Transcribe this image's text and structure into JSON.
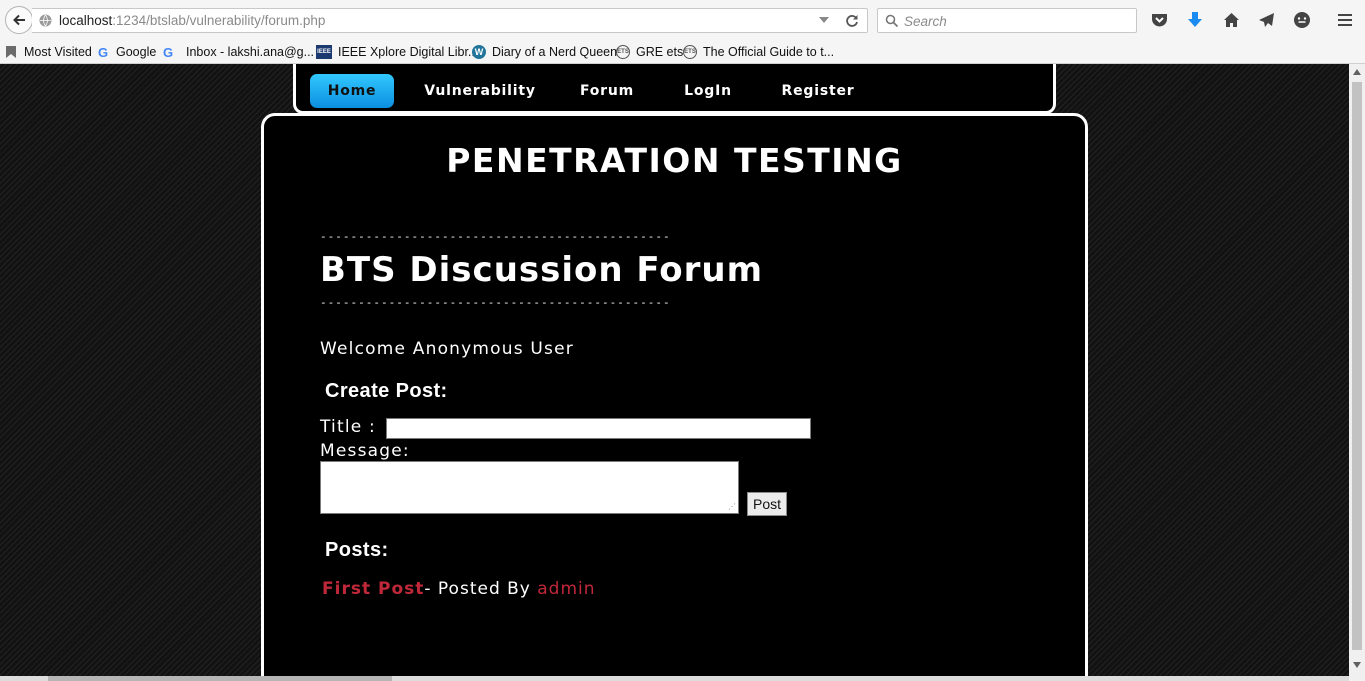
{
  "browser": {
    "url_host": "localhost",
    "url_path": ":1234/btslab/vulnerability/forum.php",
    "search_placeholder": "Search",
    "bookmarks": [
      {
        "label": "Most Visited",
        "icon": "bookmark-star-icon"
      },
      {
        "label": "Google",
        "icon": "google-icon"
      },
      {
        "label": "Inbox - lakshi.ana@g...",
        "icon": "google-icon"
      },
      {
        "label": "IEEE Xplore Digital Libr...",
        "icon": "ieee-icon"
      },
      {
        "label": "Diary of a Nerd Queen",
        "icon": "wordpress-icon"
      },
      {
        "label": "GRE ets",
        "icon": "ets-icon"
      },
      {
        "label": "The Official Guide to t...",
        "icon": "ets-icon"
      }
    ]
  },
  "nav": {
    "items": [
      "Home",
      "Vulnerability",
      "Forum",
      "LogIn",
      "Register"
    ],
    "active": "Home",
    "accent_color": "#1aa7f0"
  },
  "site_title": "PENETRATION TESTING",
  "forum": {
    "dash_line": "----------------------------------------------",
    "title": "BTS Discussion Forum",
    "welcome": "Welcome Anonymous User",
    "create_heading": "Create Post:",
    "title_label": "Title :",
    "title_value": "",
    "message_label": "Message:",
    "message_value": "",
    "post_button": "Post",
    "posts_heading": "Posts:",
    "posts": [
      {
        "title": "First Post",
        "posted_by_text": "- Posted By",
        "author": "admin"
      }
    ],
    "link_color": "#c0283a"
  }
}
